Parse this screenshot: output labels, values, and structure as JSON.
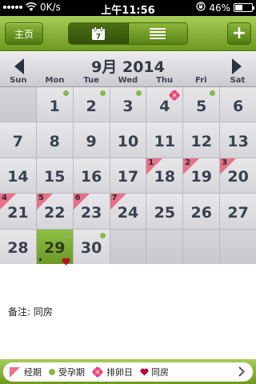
{
  "status_bar": {
    "carrier_speed": "0K/s",
    "time": "上午11:56",
    "battery": "46%",
    "battery_level": 0.46
  },
  "nav": {
    "home_label": "主页",
    "calendar_icon_text": "7",
    "add_label": "+"
  },
  "calendar": {
    "title": "9月 2014",
    "weekdays": [
      "Sun",
      "Mon",
      "Tue",
      "Wed",
      "Thu",
      "Fri",
      "Sat"
    ],
    "days": [
      {
        "day": "",
        "period": "",
        "fertile": false,
        "ovulation": false,
        "heart": false,
        "today": false
      },
      {
        "day": "1",
        "period": "",
        "fertile": true,
        "ovulation": false,
        "heart": false,
        "today": false
      },
      {
        "day": "2",
        "period": "",
        "fertile": true,
        "ovulation": false,
        "heart": false,
        "today": false
      },
      {
        "day": "3",
        "period": "",
        "fertile": true,
        "ovulation": false,
        "heart": false,
        "today": false
      },
      {
        "day": "4",
        "period": "",
        "fertile": false,
        "ovulation": true,
        "heart": false,
        "today": false
      },
      {
        "day": "5",
        "period": "",
        "fertile": true,
        "ovulation": false,
        "heart": false,
        "today": false
      },
      {
        "day": "6",
        "period": "",
        "fertile": false,
        "ovulation": false,
        "heart": false,
        "today": false
      },
      {
        "day": "7",
        "period": "",
        "fertile": false,
        "ovulation": false,
        "heart": false,
        "today": false
      },
      {
        "day": "8",
        "period": "",
        "fertile": false,
        "ovulation": false,
        "heart": false,
        "today": false
      },
      {
        "day": "9",
        "period": "",
        "fertile": false,
        "ovulation": false,
        "heart": false,
        "today": false
      },
      {
        "day": "10",
        "period": "",
        "fertile": false,
        "ovulation": false,
        "heart": false,
        "today": false
      },
      {
        "day": "11",
        "period": "",
        "fertile": false,
        "ovulation": false,
        "heart": false,
        "today": false
      },
      {
        "day": "12",
        "period": "",
        "fertile": false,
        "ovulation": false,
        "heart": false,
        "today": false
      },
      {
        "day": "13",
        "period": "",
        "fertile": false,
        "ovulation": false,
        "heart": false,
        "today": false
      },
      {
        "day": "14",
        "period": "",
        "fertile": false,
        "ovulation": false,
        "heart": false,
        "today": false
      },
      {
        "day": "15",
        "period": "",
        "fertile": false,
        "ovulation": false,
        "heart": false,
        "today": false
      },
      {
        "day": "16",
        "period": "",
        "fertile": false,
        "ovulation": false,
        "heart": false,
        "today": false
      },
      {
        "day": "17",
        "period": "",
        "fertile": false,
        "ovulation": false,
        "heart": false,
        "today": false
      },
      {
        "day": "18",
        "period": "1",
        "fertile": false,
        "ovulation": false,
        "heart": false,
        "today": false
      },
      {
        "day": "19",
        "period": "2",
        "fertile": false,
        "ovulation": false,
        "heart": false,
        "today": false
      },
      {
        "day": "20",
        "period": "3",
        "fertile": false,
        "ovulation": false,
        "heart": false,
        "today": false
      },
      {
        "day": "21",
        "period": "4",
        "fertile": false,
        "ovulation": false,
        "heart": false,
        "today": false
      },
      {
        "day": "22",
        "period": "5",
        "fertile": false,
        "ovulation": false,
        "heart": false,
        "today": false
      },
      {
        "day": "23",
        "period": "6",
        "fertile": false,
        "ovulation": false,
        "heart": false,
        "today": false
      },
      {
        "day": "24",
        "period": "7",
        "fertile": false,
        "ovulation": false,
        "heart": false,
        "today": false
      },
      {
        "day": "25",
        "period": "",
        "fertile": false,
        "ovulation": false,
        "heart": false,
        "today": false
      },
      {
        "day": "26",
        "period": "",
        "fertile": false,
        "ovulation": false,
        "heart": false,
        "today": false
      },
      {
        "day": "27",
        "period": "",
        "fertile": false,
        "ovulation": false,
        "heart": false,
        "today": false
      },
      {
        "day": "28",
        "period": "",
        "fertile": false,
        "ovulation": false,
        "heart": false,
        "today": false
      },
      {
        "day": "29",
        "period": "",
        "fertile": true,
        "ovulation": false,
        "heart": true,
        "today": true
      },
      {
        "day": "30",
        "period": "",
        "fertile": true,
        "ovulation": false,
        "heart": false,
        "today": false
      },
      {
        "day": "",
        "period": "",
        "fertile": false,
        "ovulation": false,
        "heart": false,
        "today": false
      },
      {
        "day": "",
        "period": "",
        "fertile": false,
        "ovulation": false,
        "heart": false,
        "today": false
      },
      {
        "day": "",
        "period": "",
        "fertile": false,
        "ovulation": false,
        "heart": false,
        "today": false
      },
      {
        "day": "",
        "period": "",
        "fertile": false,
        "ovulation": false,
        "heart": false,
        "today": false
      }
    ]
  },
  "note": {
    "text": "备注: 同房"
  },
  "legend": {
    "period": "经期",
    "fertile": "受孕期",
    "ovulation": "排卵日",
    "intercourse": "同房"
  },
  "colors": {
    "accent_green": "#8ab84a",
    "period_pink": "#e8708a",
    "ovulation_flower": "#e0337f",
    "heart_red": "#b0102a"
  }
}
